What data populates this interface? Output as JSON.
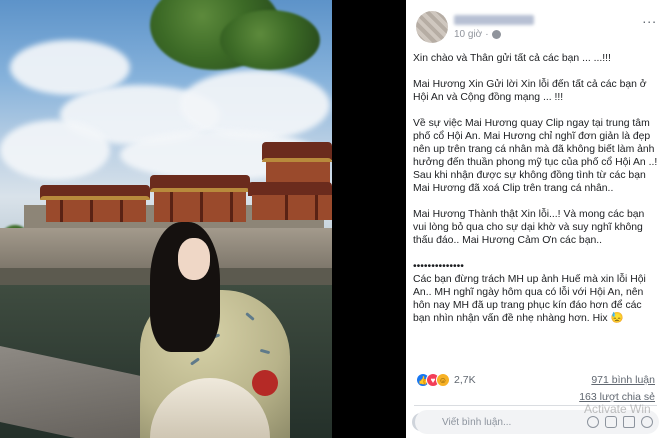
{
  "post": {
    "timestamp": "10 giờ",
    "more_label": "...",
    "paragraphs": [
      "Xin chào và Thân gửi tất cả các bạn ... ...!!!",
      "Mai Hương Xin Gửi lời Xin lỗi đến tất cả các bạn ở Hội An và Cộng đồng mạng ... !!!",
      "Về sự việc Mai Hương quay Clip ngay tại trung tâm phố cổ Hội An. Mai Hương chỉ nghĩ đơn giản là đẹp nên up trên trang cá nhân mà đã không biết làm ảnh hưởng đến thuần phong mỹ tục của phố cổ Hội An ..!\nSau khi nhận được sự không đồng tình từ các bạn Mai Hương đã xoá Clip trên trang cá nhân..",
      "Mai Hương Thành thật Xin lỗi...! Và mong các bạn vui lòng bỏ qua cho sự dại khờ và suy nghĩ không thấu đáo.. Mai Hương Cảm Ơn các bạn..",
      "••••••••••••••\nCác bạn đừng trách MH up ảnh Huế mà xin lỗi Hội An.. MH nghĩ ngày hôm qua có lỗi với Hội An, nên hôn nay MH đã up trang phục kín đáo hơn để các bạn nhìn nhận vấn đề nhẹ nhàng hơn. Hix 😓"
    ]
  },
  "engagement": {
    "reaction_count": "2,7K",
    "comments": "971 bình luận",
    "shares": "163 lượt chia sẻ"
  },
  "comment_box": {
    "placeholder": "Viết bình luận..."
  },
  "watermark": "Activate Win"
}
